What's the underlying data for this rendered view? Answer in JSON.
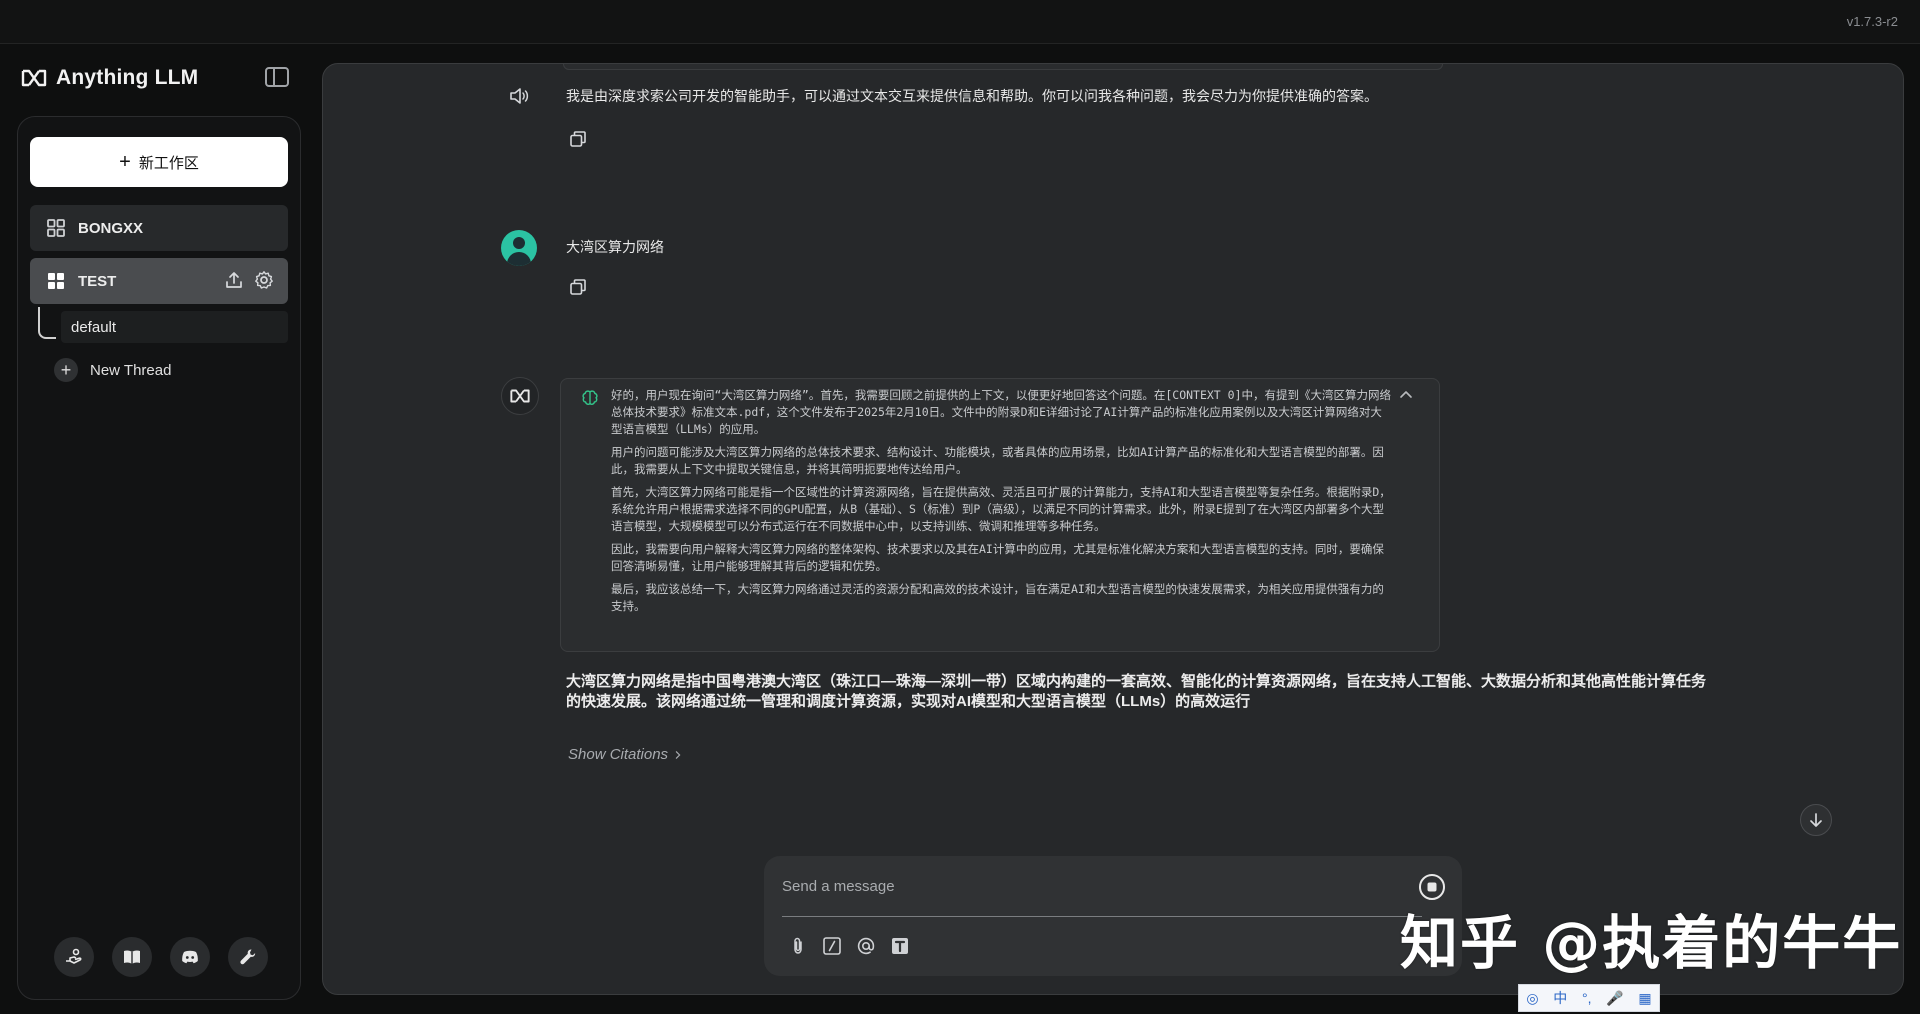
{
  "app": {
    "version": "v1.7.3-r2",
    "brand_name": "Anything LLM"
  },
  "sidebar": {
    "new_workspace_label": "新工作区",
    "workspaces": [
      {
        "name": "BONGXX",
        "active": false
      },
      {
        "name": "TEST",
        "active": true
      }
    ],
    "threads": [
      {
        "name": "default"
      }
    ],
    "new_thread_label": "New Thread",
    "footer_icons": [
      "community-hub-icon",
      "docs-book-icon",
      "discord-icon",
      "settings-wrench-icon"
    ]
  },
  "chat": {
    "previous_response": "我是由深度求索公司开发的智能助手，可以通过文本交互来提供信息和帮助。你可以问我各种问题，我会尽力为你提供准确的答案。",
    "user_message": "大湾区算力网络",
    "thinking_paragraphs": [
      "好的，用户现在询问“大湾区算力网络”。首先，我需要回顾之前提供的上下文，以便更好地回答这个问题。在[CONTEXT 0]中，有提到《大湾区算力网络总体技术要求》标准文本.pdf，这个文件发布于2025年2月10日。文件中的附录D和E详细讨论了AI计算产品的标准化应用案例以及大湾区计算网络对大型语言模型（LLMs）的应用。",
      "用户的问题可能涉及大湾区算力网络的总体技术要求、结构设计、功能模块，或者具体的应用场景，比如AI计算产品的标准化和大型语言模型的部署。因此，我需要从上下文中提取关键信息，并将其简明扼要地传达给用户。",
      "首先，大湾区算力网络可能是指一个区域性的计算资源网络，旨在提供高效、灵活且可扩展的计算能力，支持AI和大型语言模型等复杂任务。根据附录D，系统允许用户根据需求选择不同的GPU配置，从B（基础）、S（标准）到P（高级），以满足不同的计算需求。此外，附录E提到了在大湾区内部署多个大型语言模型，大规模模型可以分布式运行在不同数据中心中，以支持训练、微调和推理等多种任务。",
      "因此，我需要向用户解释大湾区算力网络的整体架构、技术要求以及其在AI计算中的应用，尤其是标准化解决方案和大型语言模型的支持。同时，要确保回答清晰易懂，让用户能够理解其背后的逻辑和优势。",
      "最后，我应该总结一下，大湾区算力网络通过灵活的资源分配和高效的技术设计，旨在满足AI和大型语言模型的快速发展需求，为相关应用提供强有力的支持。"
    ],
    "answer": "大湾区算力网络是指中国粤港澳大湾区（珠江口—珠海—深圳一带）区域内构建的一套高效、智能化的计算资源网络，旨在支持人工智能、大数据分析和其他高性能计算任务的快速发展。该网络通过统一管理和调度计算资源，实现对AI模型和大型语言模型（LLMs）的高效运行",
    "show_citations_label": "Show Citations"
  },
  "composer": {
    "placeholder": "Send a message",
    "value": ""
  },
  "watermark": "知乎 @执着的牛牛",
  "ime": [
    "中",
    "°,",
    "🎤",
    "▦"
  ],
  "colors": {
    "avatar_user": "#2bc3a3",
    "background": "#0e0f0f",
    "panel": "#26282a"
  }
}
